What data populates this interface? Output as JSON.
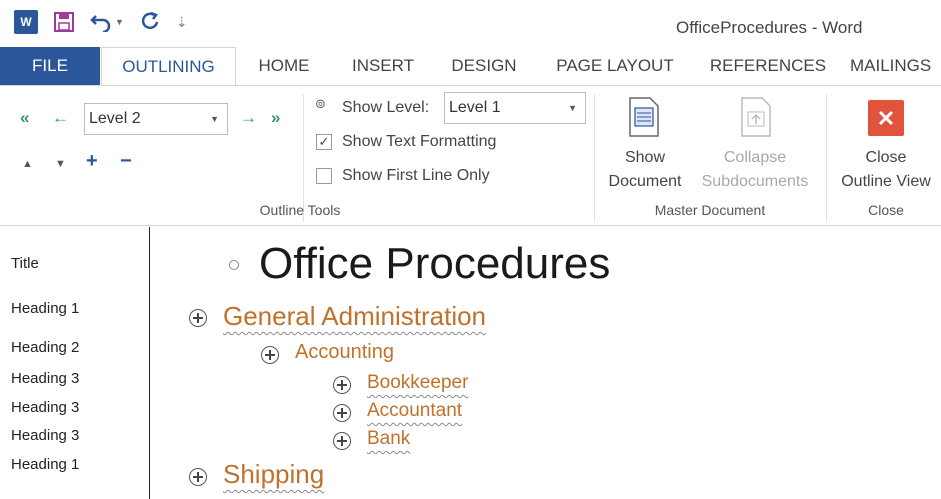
{
  "window": {
    "title": "OfficeProcedures - Word"
  },
  "quick_access": {
    "app_icon": "word-icon",
    "save_icon": "save-icon",
    "undo_icon": "undo-icon",
    "redo_icon": "repeat-icon",
    "customize_icon": "customize-icon"
  },
  "tabs": {
    "file": "FILE",
    "outlining": "OUTLINING",
    "home": "HOME",
    "insert": "INSERT",
    "design": "DESIGN",
    "page_layout": "PAGE LAYOUT",
    "references": "REFERENCES",
    "mailings": "MAILINGS"
  },
  "outline_tools": {
    "level_value": "Level 2",
    "show_level_label": "Show Level:",
    "show_level_value": "Level 1",
    "show_text_formatting": "Show Text Formatting",
    "show_text_formatting_checked": true,
    "show_first_line_only": "Show First Line Only",
    "show_first_line_only_checked": false,
    "group_label": "Outline Tools"
  },
  "master_document": {
    "show_document_line1": "Show",
    "show_document_line2": "Document",
    "collapse_line1": "Collapse",
    "collapse_line2": "Subdocuments",
    "group_label": "Master Document"
  },
  "close_group": {
    "close_line1": "Close",
    "close_line2": "Outline View",
    "group_label": "Close"
  },
  "style_pane": [
    "Title",
    "Heading 1",
    "Heading 2",
    "Heading 3",
    "Heading 3",
    "Heading 3",
    "Heading 1"
  ],
  "outline": {
    "title": "Office Procedures",
    "general_administration": "General Administration",
    "accounting": "Accounting",
    "bookkeeper": "Bookkeeper",
    "accountant": "Accountant",
    "bank": "Bank",
    "shipping": "Shipping"
  },
  "colors": {
    "accent": "#2b579a",
    "heading": "#c0722c",
    "close_red": "#e0533d",
    "arrow_green": "#2f9a6a"
  }
}
